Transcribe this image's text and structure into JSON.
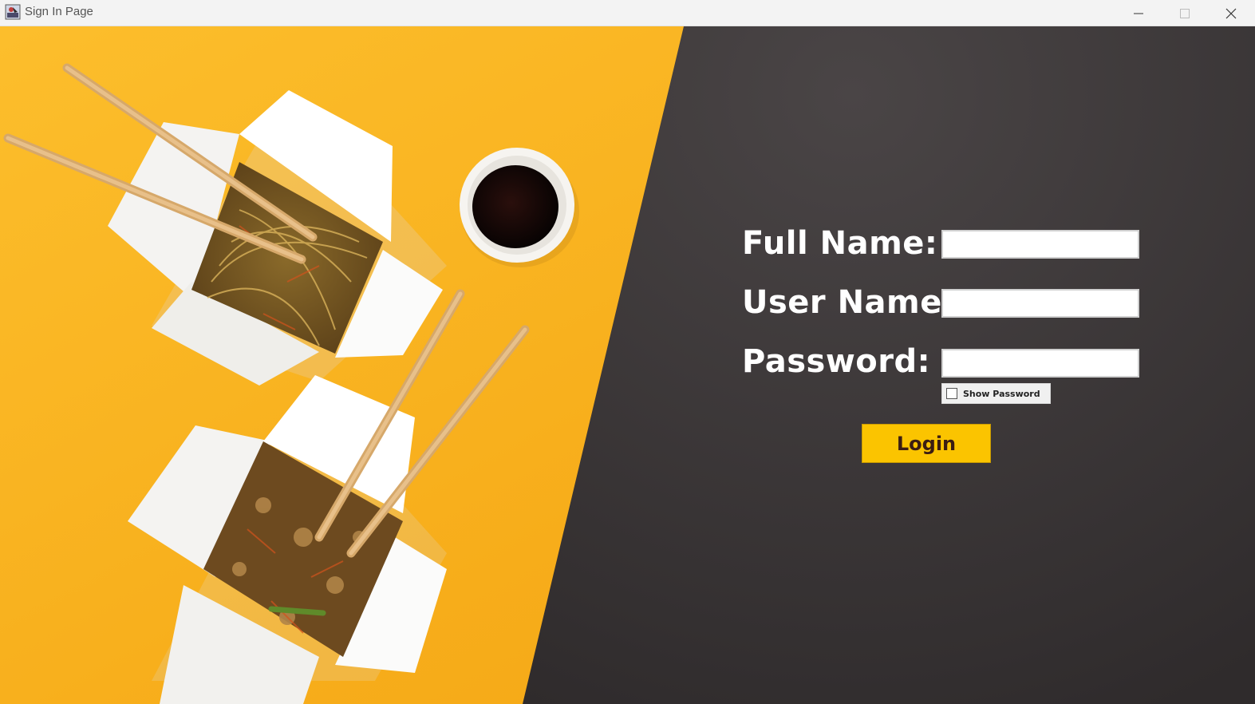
{
  "window": {
    "title": "Sign In Page",
    "controls": [
      "minimize",
      "maximize",
      "close"
    ]
  },
  "form": {
    "full_name_label": "Full Name:",
    "full_name_value": "",
    "user_name_label": "User Name:",
    "user_name_value": "",
    "password_label": "Password:",
    "password_value": "",
    "show_password_label": "Show Password",
    "show_password_checked": false,
    "login_label": "Login"
  },
  "colors": {
    "yellow_background": "#f9b521",
    "dark_background": "#353132",
    "login_button": "#fbc400",
    "login_text": "#3b1d12"
  }
}
